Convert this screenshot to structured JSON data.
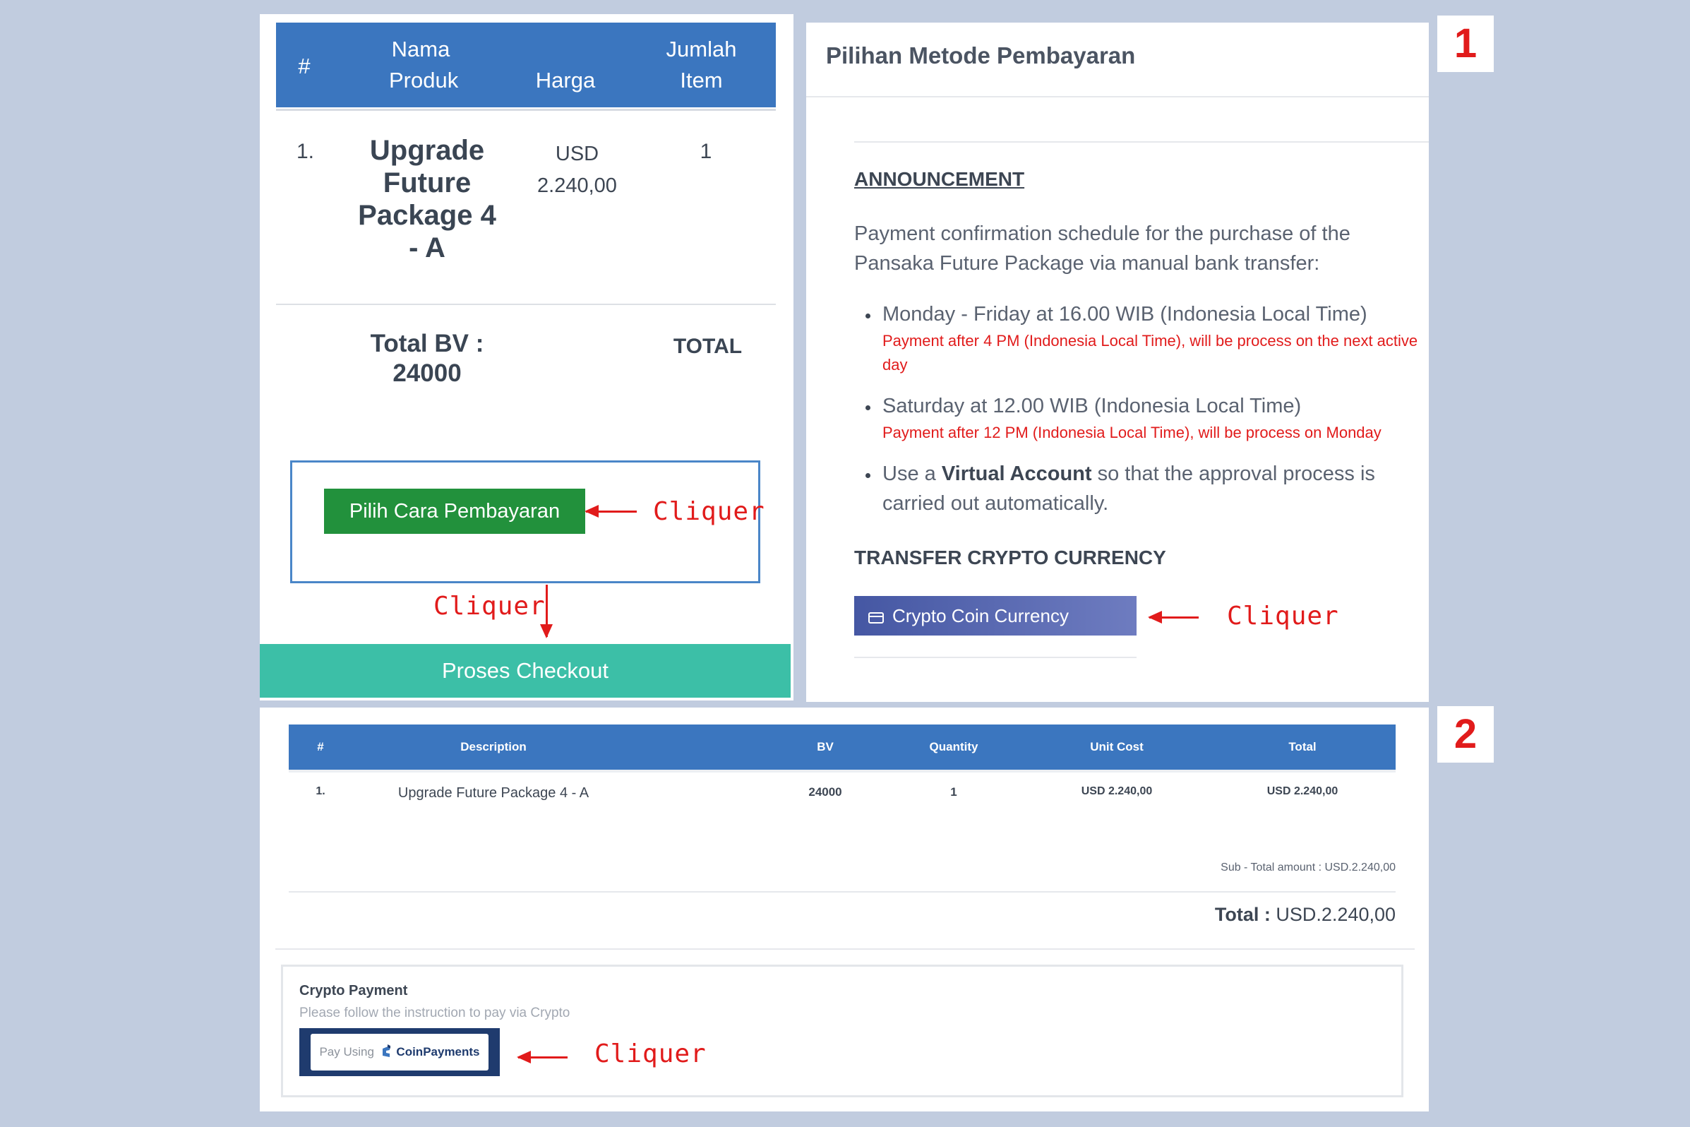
{
  "badges": {
    "one": "1",
    "two": "2"
  },
  "cart": {
    "headers": {
      "number": "#",
      "product": "Nama Produk",
      "price": "Harga",
      "quantity": "Jumlah Item"
    },
    "row": {
      "number": "1.",
      "product": "Upgrade Future Package 4 - A",
      "price": "USD 2.240,00",
      "quantity": "1"
    },
    "total_bv_label": "Total BV :",
    "total_bv_value": "24000",
    "total_label": "TOTAL",
    "choose_payment_button": "Pilih Cara Pembayaran",
    "checkout_button": "Proses Checkout"
  },
  "annotations": {
    "click": "Cliquer"
  },
  "payment_panel": {
    "title": "Pilihan Metode Pembayaran",
    "announcement_heading": "ANNOUNCEMENT",
    "intro": "Payment confirmation schedule for the purchase of the Pansaka Future Package via manual bank transfer:",
    "items": [
      {
        "text": "Monday - Friday at 16.00 WIB (Indonesia Local Time)",
        "note": "Payment after 4 PM (Indonesia Local Time), will be process on the next active day"
      },
      {
        "text": "Saturday at 12.00 WIB (Indonesia Local Time)",
        "note": "Payment after 12 PM (Indonesia Local Time), will be process on Monday"
      }
    ],
    "va_prefix": "Use a ",
    "va_bold": "Virtual Account",
    "va_suffix": " so that the approval process is carried out automatically.",
    "crypto_heading": "TRANSFER CRYPTO CURRENCY",
    "crypto_button": "Crypto Coin Currency",
    "crypto_icon": "credit-card-icon"
  },
  "invoice": {
    "headers": [
      "#",
      "Description",
      "BV",
      "Quantity",
      "Unit Cost",
      "Total"
    ],
    "row": [
      "1.",
      "Upgrade Future Package 4 - A",
      "24000",
      "1",
      "USD 2.240,00",
      "USD 2.240,00"
    ],
    "subtotal": "Sub - Total amount : USD.2.240,00",
    "total_label": "Total :",
    "total_value": "USD.2.240,00",
    "crypto_title": "Crypto Payment",
    "crypto_instruction": "Please follow the instruction to pay via Crypto",
    "pay_using": "Pay Using",
    "coinpayments": "CoinPayments"
  },
  "colors": {
    "header_blue": "#3b76bf",
    "green_button": "#22913c",
    "checkout_teal": "#3cbfa7",
    "crypto_button": "#4e5ca3",
    "annotation_red": "#e11b1b",
    "background": "#c1ccdf"
  }
}
